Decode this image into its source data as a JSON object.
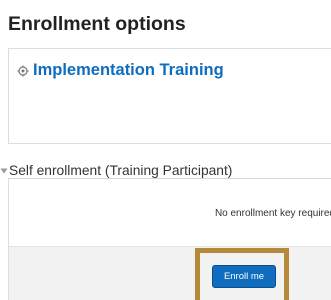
{
  "page": {
    "title": "Enrollment options"
  },
  "course": {
    "name": "Implementation Training",
    "icon": "course-icon"
  },
  "enrolment": {
    "section_title": "Self enrollment (Training Participant)",
    "toggle_icon": "expanded-triangle-icon",
    "key_message": "No enrollment key required",
    "button_label": "Enroll me"
  },
  "colors": {
    "link": "#0f6cbf",
    "button": "#0f6cbf",
    "highlight": "#b58a3a"
  }
}
